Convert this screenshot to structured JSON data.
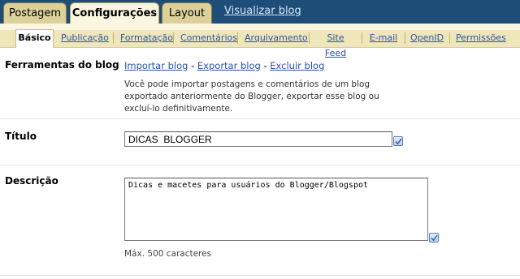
{
  "top_tabs": [
    {
      "label": "Postagem"
    },
    {
      "label": "Configurações"
    },
    {
      "label": "Layout"
    }
  ],
  "top_link": "Visualizar blog",
  "sub_tabs": [
    {
      "label": "Básico"
    },
    {
      "label": "Publicação"
    },
    {
      "label": "Formatação"
    },
    {
      "label": "Comentários"
    },
    {
      "label": "Arquivamento"
    },
    {
      "label": "Site Feed"
    },
    {
      "label": "E-mail"
    },
    {
      "label": "OpenID"
    },
    {
      "label": "Permissões"
    }
  ],
  "tools": {
    "label": "Ferramentas do blog",
    "import": "Importar blog",
    "export": "Exportar blog",
    "delete": "Excluir blog",
    "separator": " - ",
    "description": "Você pode importar postagens e comentários de um blog exportado anteriormente do Blogger, exportar esse blog ou excluí-lo definitivamente."
  },
  "title_field": {
    "label": "Título",
    "value": "DICAS  BLOGGER"
  },
  "description_field": {
    "label": "Descrição",
    "value": "Dicas e macetes para usuários do Blogger/Blogspot",
    "hint": "Máx. 500 caracteres"
  },
  "icons": {
    "spellcheck": "spellcheck-icon"
  }
}
